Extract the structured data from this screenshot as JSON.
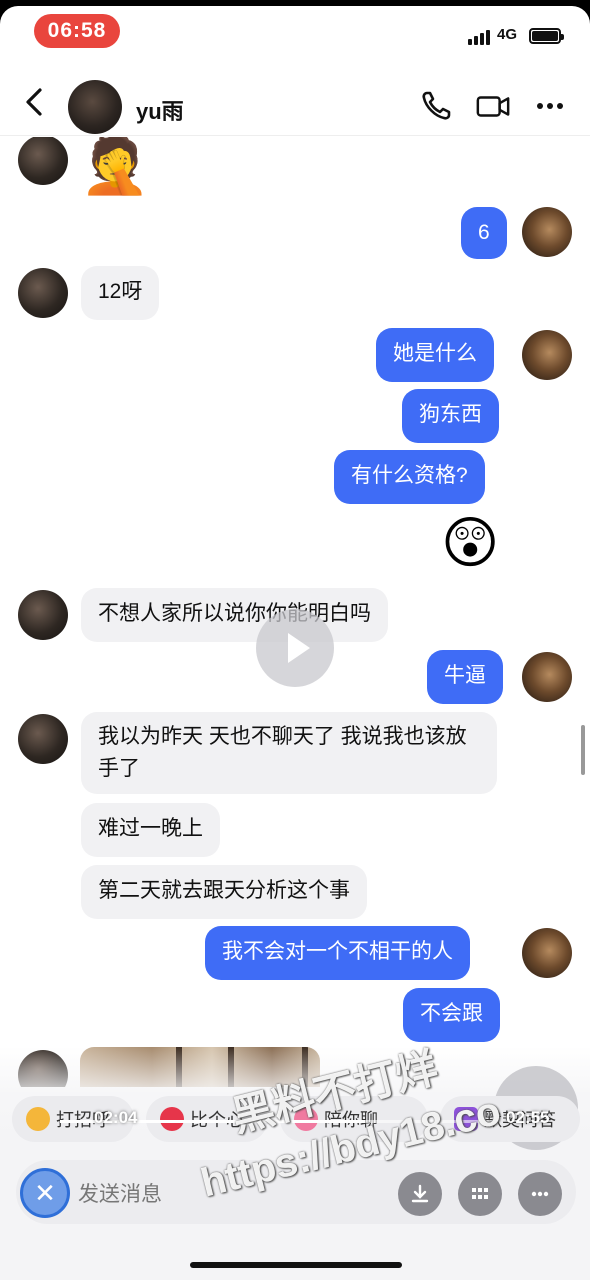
{
  "status_bar": {
    "time": "06:58",
    "network": "4G",
    "battery_level": 1.0
  },
  "header": {
    "contact_name": "yu雨",
    "icons": [
      "back-icon",
      "phone-icon",
      "video-call-icon",
      "more-icon"
    ]
  },
  "messages": [
    {
      "side": "in",
      "type": "emoji",
      "emoji": "🤦"
    },
    {
      "side": "out",
      "type": "text",
      "text": "6"
    },
    {
      "side": "in",
      "type": "text",
      "text": "12呀"
    },
    {
      "side": "out",
      "type": "text",
      "text": "她是什么"
    },
    {
      "side": "out",
      "type": "text",
      "text": "狗东西"
    },
    {
      "side": "out",
      "type": "text",
      "text": "有什么资格?"
    },
    {
      "side": "out",
      "type": "emoji",
      "emoji": "😲"
    },
    {
      "side": "in",
      "type": "text",
      "text": "不想人家所以说你你能明白吗"
    },
    {
      "side": "out",
      "type": "text",
      "text": "牛逼"
    },
    {
      "side": "in",
      "type": "text",
      "text": "我以为昨天 天也不聊天了 我说我也该放手了"
    },
    {
      "side": "in",
      "type": "text",
      "text": "难过一晚上"
    },
    {
      "side": "in",
      "type": "text",
      "text": "第二天就去跟天分析这个事"
    },
    {
      "side": "out",
      "type": "text",
      "text": "我不会对一个不相干的人"
    },
    {
      "side": "out",
      "type": "text",
      "text": "不会跟"
    },
    {
      "side": "in",
      "type": "image"
    }
  ],
  "quick_replies": [
    "打招呼",
    "比个心",
    "陪你聊",
    "默契问答"
  ],
  "video": {
    "current_time": "02:04",
    "total_time": "02:55",
    "progress": 0.71
  },
  "input": {
    "placeholder": "发送消息"
  },
  "watermark": {
    "line1": "黑料不打烊",
    "line2": "https://bdy18.co"
  },
  "colors": {
    "outgoing_bubble": "#3f6cf6",
    "incoming_bubble": "#f1f1f3",
    "time_pill": "#e9453d"
  }
}
